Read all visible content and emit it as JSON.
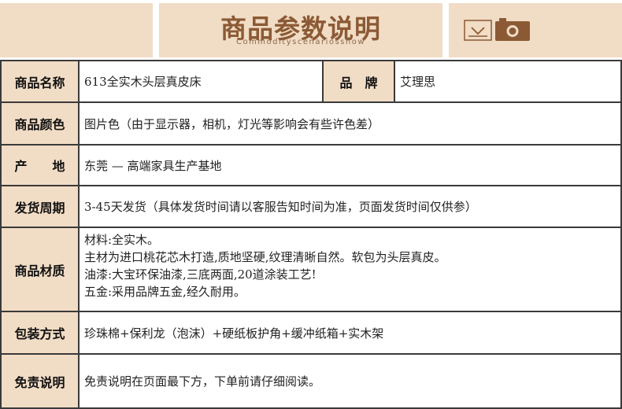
{
  "header": {
    "title": "商品参数说明",
    "subtitle": "Commodityscenariosshow",
    "icons": [
      "envelope-icon",
      "camera-icon"
    ]
  },
  "colors": {
    "label_bg": "#f1dcc5",
    "title_brown": "#8b5a35",
    "border": "#3a3a3a"
  },
  "rows": [
    {
      "label": "商品名称",
      "value": "613全实木头层真皮床",
      "label2": "品　牌",
      "value2": "艾理思"
    },
    {
      "label": "商品颜色",
      "value": "图片色（由于显示器，相机，灯光等影响会有些许色差）"
    },
    {
      "label": "产　　地",
      "value": "东莞 — 高端家具生产基地"
    },
    {
      "label": "发货周期",
      "value": "3-45天发货（具体发货时间请以客服告知时间为准，页面发货时间仅供参）"
    },
    {
      "label": "商品材质",
      "lines": [
        "材料:全实木。",
        "主材为进口桃花芯木打造,质地坚硬,纹理清晰自然。软包为头层真皮。",
        "油漆:大宝环保油漆,三底两面,20道涂装工艺!",
        "五金:采用品牌五金,经久耐用。"
      ]
    },
    {
      "label": "包装方式",
      "value": "珍珠棉+保利龙（泡沫）+硬纸板护角+缓冲纸箱+实木架"
    },
    {
      "label": "免责说明",
      "value": "免责说明在页面最下方，下单前请仔细阅读。"
    }
  ]
}
